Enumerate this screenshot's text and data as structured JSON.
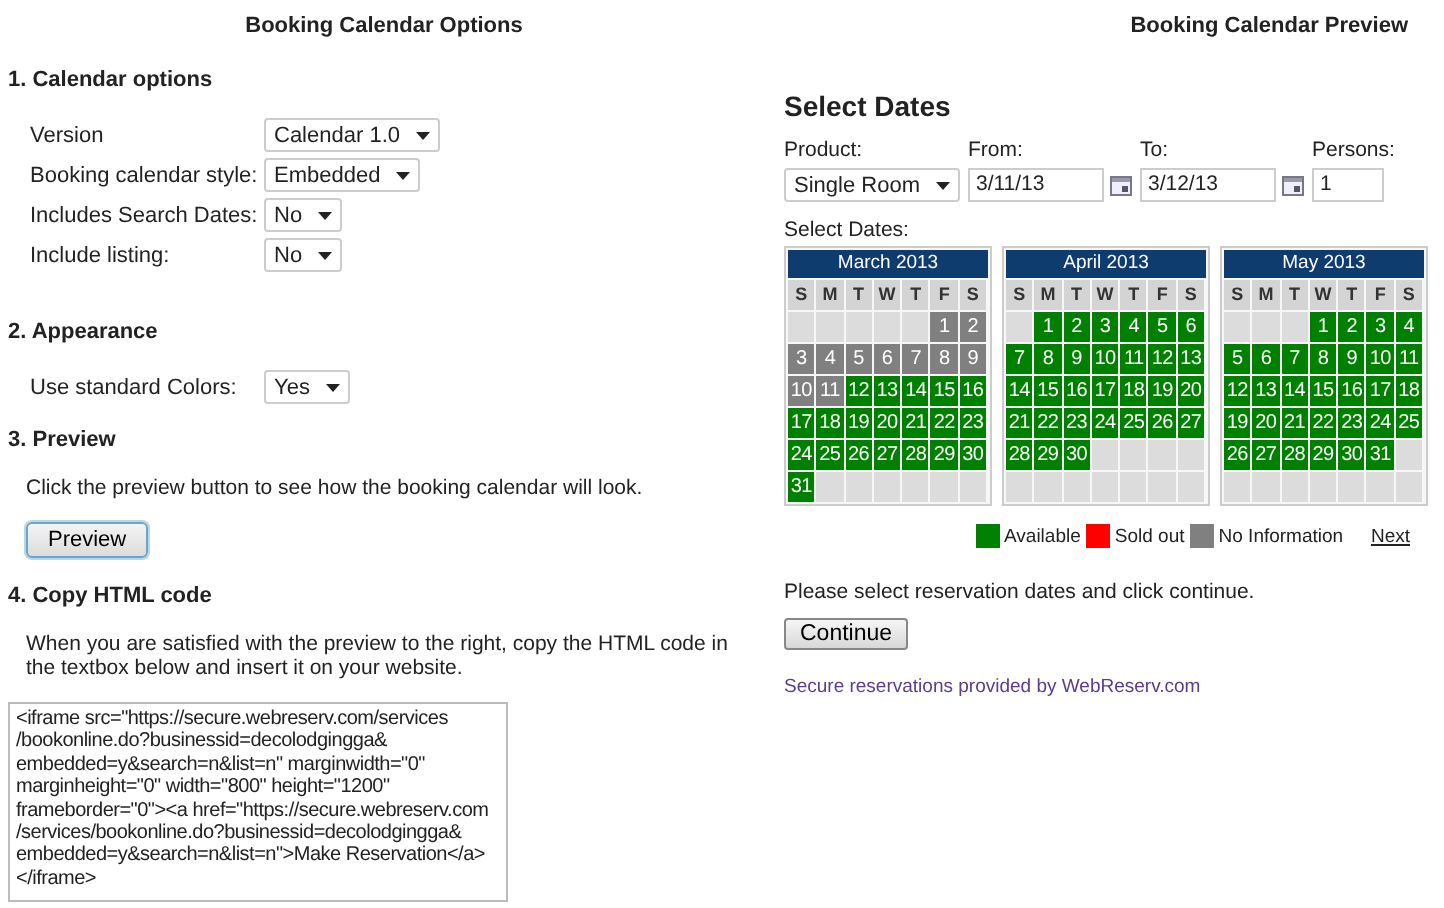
{
  "options_panel": {
    "title": "Booking Calendar Options",
    "sections": [
      {
        "heading": "1. Calendar options",
        "fields": [
          {
            "label": "Version",
            "value": "Calendar 1.0"
          },
          {
            "label": "Booking calendar style:",
            "value": "Embedded"
          },
          {
            "label": "Includes Search Dates:",
            "value": "No"
          },
          {
            "label": "Include listing:",
            "value": "No"
          }
        ]
      },
      {
        "heading": "2. Appearance",
        "fields": [
          {
            "label": "Use standard Colors:",
            "value": "Yes"
          }
        ]
      },
      {
        "heading": "3. Preview",
        "text": "Click the preview button to see how the booking calendar will look.",
        "button": "Preview"
      },
      {
        "heading": "4. Copy HTML code",
        "text": "When you are satisfied with the preview to the right, copy the HTML code in the textbox below and insert it on your website.",
        "code_lines": [
          "<iframe src=\"https://secure.webreserv.com/services",
          "/bookonline.do?businessid=decolodgingga&",
          "embedded=y&search=n&list=n\" marginwidth=\"0\"",
          "marginheight=\"0\" width=\"800\" height=\"1200\"",
          "frameborder=\"0\"><a href=\"https://secure.webreserv.com",
          "/services/bookonline.do?businessid=decolodgingga&",
          "embedded=y&search=n&list=n\">Make Reservation</a>",
          "</iframe>"
        ]
      }
    ]
  },
  "preview_panel": {
    "title": "Booking Calendar Preview",
    "heading": "Select Dates",
    "search": {
      "product": {
        "label": "Product:",
        "value": "Single Room"
      },
      "from": {
        "label": "From:",
        "value": "3/11/13"
      },
      "to": {
        "label": "To:",
        "value": "3/12/13"
      },
      "persons": {
        "label": "Persons:",
        "value": "1"
      }
    },
    "calendar_label": "Select Dates:",
    "months": [
      {
        "title": "March 2013",
        "weekdays": [
          "S",
          "M",
          "T",
          "W",
          "T",
          "F",
          "S"
        ],
        "weeks": [
          [
            {
              "kind": "blank"
            },
            {
              "kind": "blank"
            },
            {
              "kind": "blank"
            },
            {
              "kind": "blank"
            },
            {
              "kind": "blank"
            },
            {
              "kind": "day",
              "day": "1",
              "color": "#808080"
            },
            {
              "kind": "day",
              "day": "2",
              "color": "#808080"
            }
          ],
          [
            {
              "kind": "day",
              "day": "3",
              "color": "#808080"
            },
            {
              "kind": "day",
              "day": "4",
              "color": "#808080"
            },
            {
              "kind": "day",
              "day": "5",
              "color": "#808080"
            },
            {
              "kind": "day",
              "day": "6",
              "color": "#808080"
            },
            {
              "kind": "day",
              "day": "7",
              "color": "#808080"
            },
            {
              "kind": "day",
              "day": "8",
              "color": "#808080"
            },
            {
              "kind": "day",
              "day": "9",
              "color": "#808080"
            }
          ],
          [
            {
              "kind": "day",
              "day": "10",
              "color": "#808080"
            },
            {
              "kind": "day",
              "day": "11",
              "color": "#808080"
            },
            {
              "kind": "day",
              "day": "12",
              "color": "#008000"
            },
            {
              "kind": "day",
              "day": "13",
              "color": "#008000"
            },
            {
              "kind": "day",
              "day": "14",
              "color": "#008000"
            },
            {
              "kind": "day",
              "day": "15",
              "color": "#008000"
            },
            {
              "kind": "day",
              "day": "16",
              "color": "#008000"
            }
          ],
          [
            {
              "kind": "day",
              "day": "17",
              "color": "#008000"
            },
            {
              "kind": "day",
              "day": "18",
              "color": "#008000"
            },
            {
              "kind": "day",
              "day": "19",
              "color": "#008000"
            },
            {
              "kind": "day",
              "day": "20",
              "color": "#008000"
            },
            {
              "kind": "day",
              "day": "21",
              "color": "#008000"
            },
            {
              "kind": "day",
              "day": "22",
              "color": "#008000"
            },
            {
              "kind": "day",
              "day": "23",
              "color": "#008000"
            }
          ],
          [
            {
              "kind": "day",
              "day": "24",
              "color": "#008000"
            },
            {
              "kind": "day",
              "day": "25",
              "color": "#008000"
            },
            {
              "kind": "day",
              "day": "26",
              "color": "#008000"
            },
            {
              "kind": "day",
              "day": "27",
              "color": "#008000"
            },
            {
              "kind": "day",
              "day": "28",
              "color": "#008000"
            },
            {
              "kind": "day",
              "day": "29",
              "color": "#008000"
            },
            {
              "kind": "day",
              "day": "30",
              "color": "#008000"
            }
          ],
          [
            {
              "kind": "day",
              "day": "31",
              "color": "#008000"
            },
            {
              "kind": "blank"
            },
            {
              "kind": "blank"
            },
            {
              "kind": "blank"
            },
            {
              "kind": "blank"
            },
            {
              "kind": "blank"
            },
            {
              "kind": "blank"
            }
          ]
        ]
      },
      {
        "title": "April 2013",
        "weekdays": [
          "S",
          "M",
          "T",
          "W",
          "T",
          "F",
          "S"
        ],
        "weeks": [
          [
            {
              "kind": "blank"
            },
            {
              "kind": "day",
              "day": "1",
              "color": "#008000"
            },
            {
              "kind": "day",
              "day": "2",
              "color": "#008000"
            },
            {
              "kind": "day",
              "day": "3",
              "color": "#008000"
            },
            {
              "kind": "day",
              "day": "4",
              "color": "#008000"
            },
            {
              "kind": "day",
              "day": "5",
              "color": "#008000"
            },
            {
              "kind": "day",
              "day": "6",
              "color": "#008000"
            }
          ],
          [
            {
              "kind": "day",
              "day": "7",
              "color": "#008000"
            },
            {
              "kind": "day",
              "day": "8",
              "color": "#008000"
            },
            {
              "kind": "day",
              "day": "9",
              "color": "#008000"
            },
            {
              "kind": "day",
              "day": "10",
              "color": "#008000"
            },
            {
              "kind": "day",
              "day": "11",
              "color": "#008000"
            },
            {
              "kind": "day",
              "day": "12",
              "color": "#008000"
            },
            {
              "kind": "day",
              "day": "13",
              "color": "#008000"
            }
          ],
          [
            {
              "kind": "day",
              "day": "14",
              "color": "#008000"
            },
            {
              "kind": "day",
              "day": "15",
              "color": "#008000"
            },
            {
              "kind": "day",
              "day": "16",
              "color": "#008000"
            },
            {
              "kind": "day",
              "day": "17",
              "color": "#008000"
            },
            {
              "kind": "day",
              "day": "18",
              "color": "#008000"
            },
            {
              "kind": "day",
              "day": "19",
              "color": "#008000"
            },
            {
              "kind": "day",
              "day": "20",
              "color": "#008000"
            }
          ],
          [
            {
              "kind": "day",
              "day": "21",
              "color": "#008000"
            },
            {
              "kind": "day",
              "day": "22",
              "color": "#008000"
            },
            {
              "kind": "day",
              "day": "23",
              "color": "#008000"
            },
            {
              "kind": "day",
              "day": "24",
              "color": "#008000"
            },
            {
              "kind": "day",
              "day": "25",
              "color": "#008000"
            },
            {
              "kind": "day",
              "day": "26",
              "color": "#008000"
            },
            {
              "kind": "day",
              "day": "27",
              "color": "#008000"
            }
          ],
          [
            {
              "kind": "day",
              "day": "28",
              "color": "#008000"
            },
            {
              "kind": "day",
              "day": "29",
              "color": "#008000"
            },
            {
              "kind": "day",
              "day": "30",
              "color": "#008000"
            },
            {
              "kind": "blank"
            },
            {
              "kind": "blank"
            },
            {
              "kind": "blank"
            },
            {
              "kind": "blank"
            }
          ],
          [
            {
              "kind": "blank"
            },
            {
              "kind": "blank"
            },
            {
              "kind": "blank"
            },
            {
              "kind": "blank"
            },
            {
              "kind": "blank"
            },
            {
              "kind": "blank"
            },
            {
              "kind": "blank"
            }
          ]
        ]
      },
      {
        "title": "May 2013",
        "weekdays": [
          "S",
          "M",
          "T",
          "W",
          "T",
          "F",
          "S"
        ],
        "weeks": [
          [
            {
              "kind": "blank"
            },
            {
              "kind": "blank"
            },
            {
              "kind": "blank"
            },
            {
              "kind": "day",
              "day": "1",
              "color": "#008000"
            },
            {
              "kind": "day",
              "day": "2",
              "color": "#008000"
            },
            {
              "kind": "day",
              "day": "3",
              "color": "#008000"
            },
            {
              "kind": "day",
              "day": "4",
              "color": "#008000"
            }
          ],
          [
            {
              "kind": "day",
              "day": "5",
              "color": "#008000"
            },
            {
              "kind": "day",
              "day": "6",
              "color": "#008000"
            },
            {
              "kind": "day",
              "day": "7",
              "color": "#008000"
            },
            {
              "kind": "day",
              "day": "8",
              "color": "#008000"
            },
            {
              "kind": "day",
              "day": "9",
              "color": "#008000"
            },
            {
              "kind": "day",
              "day": "10",
              "color": "#008000"
            },
            {
              "kind": "day",
              "day": "11",
              "color": "#008000"
            }
          ],
          [
            {
              "kind": "day",
              "day": "12",
              "color": "#008000"
            },
            {
              "kind": "day",
              "day": "13",
              "color": "#008000"
            },
            {
              "kind": "day",
              "day": "14",
              "color": "#008000"
            },
            {
              "kind": "day",
              "day": "15",
              "color": "#008000"
            },
            {
              "kind": "day",
              "day": "16",
              "color": "#008000"
            },
            {
              "kind": "day",
              "day": "17",
              "color": "#008000"
            },
            {
              "kind": "day",
              "day": "18",
              "color": "#008000"
            }
          ],
          [
            {
              "kind": "day",
              "day": "19",
              "color": "#008000"
            },
            {
              "kind": "day",
              "day": "20",
              "color": "#008000"
            },
            {
              "kind": "day",
              "day": "21",
              "color": "#008000"
            },
            {
              "kind": "day",
              "day": "22",
              "color": "#008000"
            },
            {
              "kind": "day",
              "day": "23",
              "color": "#008000"
            },
            {
              "kind": "day",
              "day": "24",
              "color": "#008000"
            },
            {
              "kind": "day",
              "day": "25",
              "color": "#008000"
            }
          ],
          [
            {
              "kind": "day",
              "day": "26",
              "color": "#008000"
            },
            {
              "kind": "day",
              "day": "27",
              "color": "#008000"
            },
            {
              "kind": "day",
              "day": "28",
              "color": "#008000"
            },
            {
              "kind": "day",
              "day": "29",
              "color": "#008000"
            },
            {
              "kind": "day",
              "day": "30",
              "color": "#008000"
            },
            {
              "kind": "day",
              "day": "31",
              "color": "#008000"
            },
            {
              "kind": "blank"
            }
          ],
          [
            {
              "kind": "blank"
            },
            {
              "kind": "blank"
            },
            {
              "kind": "blank"
            },
            {
              "kind": "blank"
            },
            {
              "kind": "blank"
            },
            {
              "kind": "blank"
            },
            {
              "kind": "blank"
            }
          ]
        ]
      }
    ],
    "legend": [
      {
        "label": "Available",
        "color": "#008000"
      },
      {
        "label": "Sold out",
        "color": "#ff0000"
      },
      {
        "label": "No Information",
        "color": "#808080"
      }
    ],
    "next_link": "Next",
    "instruction": "Please select reservation dates and click continue.",
    "button": "Continue",
    "footer_link": "Secure reservations provided by WebReserv.com"
  }
}
